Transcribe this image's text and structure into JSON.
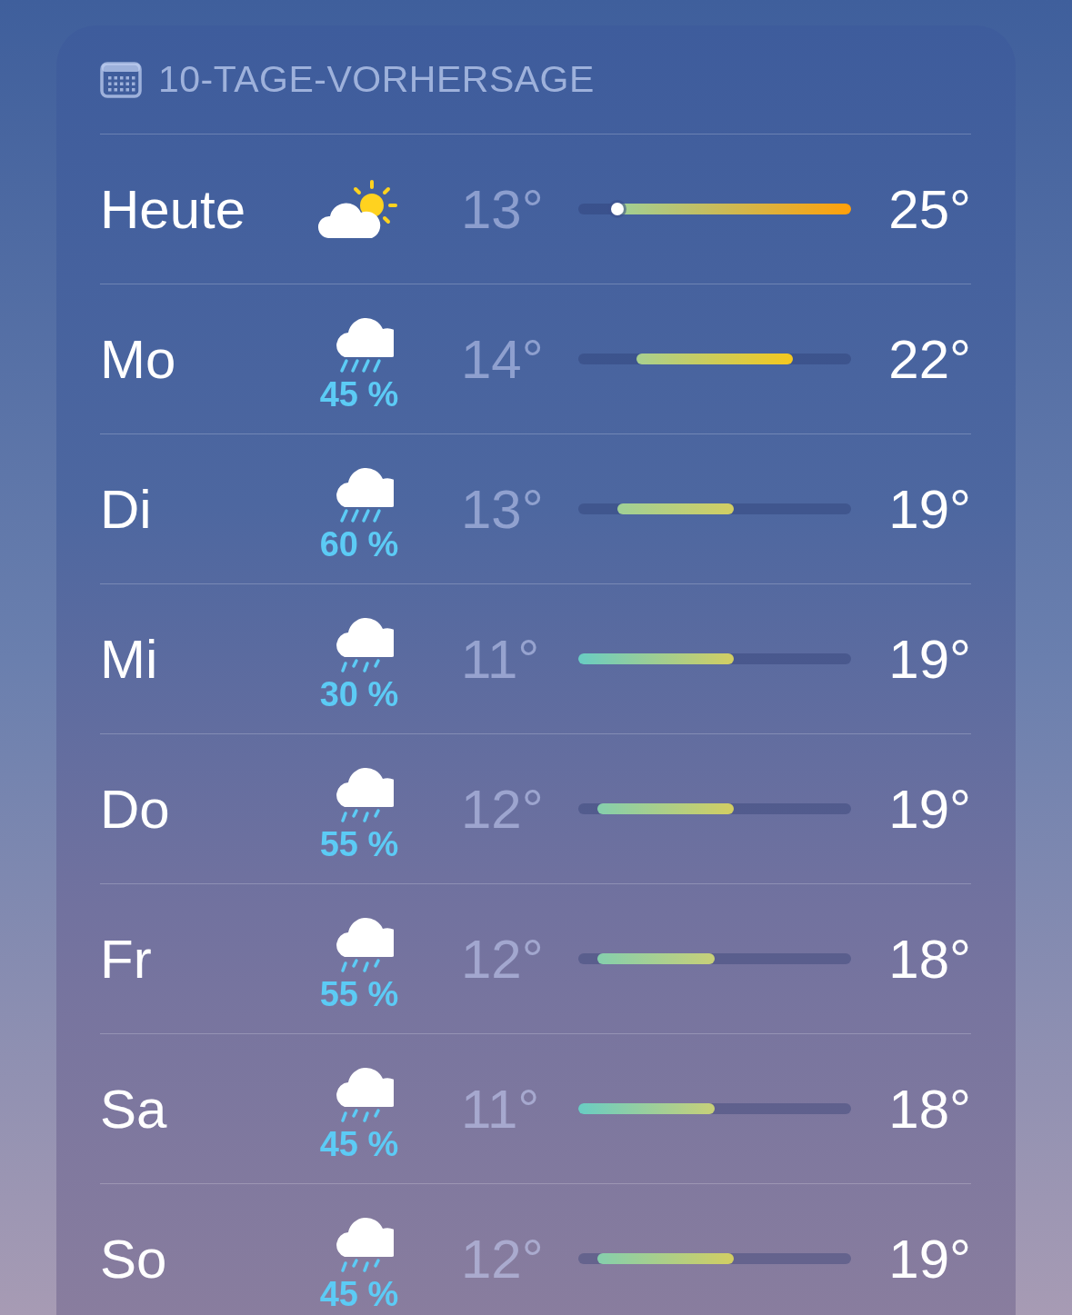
{
  "header": {
    "title": "10-TAGE-VORHERSAGE"
  },
  "days": [
    {
      "day": "Heute",
      "kind": "sun-cloud",
      "low": "13°",
      "high": "25°",
      "current_marker": true
    },
    {
      "day": "Mo",
      "kind": "rain",
      "precip": "45 %",
      "low": "14°",
      "high": "22°",
      "current_marker": false
    },
    {
      "day": "Di",
      "kind": "rain",
      "precip": "60 %",
      "low": "13°",
      "high": "19°",
      "current_marker": false
    },
    {
      "day": "Mi",
      "kind": "drizzle",
      "precip": "30 %",
      "low": "11°",
      "high": "19°",
      "current_marker": false
    },
    {
      "day": "Do",
      "kind": "drizzle",
      "precip": "55 %",
      "low": "12°",
      "high": "19°",
      "current_marker": false
    },
    {
      "day": "Fr",
      "kind": "drizzle",
      "precip": "55 %",
      "low": "12°",
      "high": "18°",
      "current_marker": false
    },
    {
      "day": "Sa",
      "kind": "drizzle",
      "precip": "45 %",
      "low": "11°",
      "high": "18°",
      "current_marker": false
    },
    {
      "day": "So",
      "kind": "drizzle",
      "precip": "45 %",
      "low": "12°",
      "high": "19°",
      "current_marker": false
    }
  ]
}
